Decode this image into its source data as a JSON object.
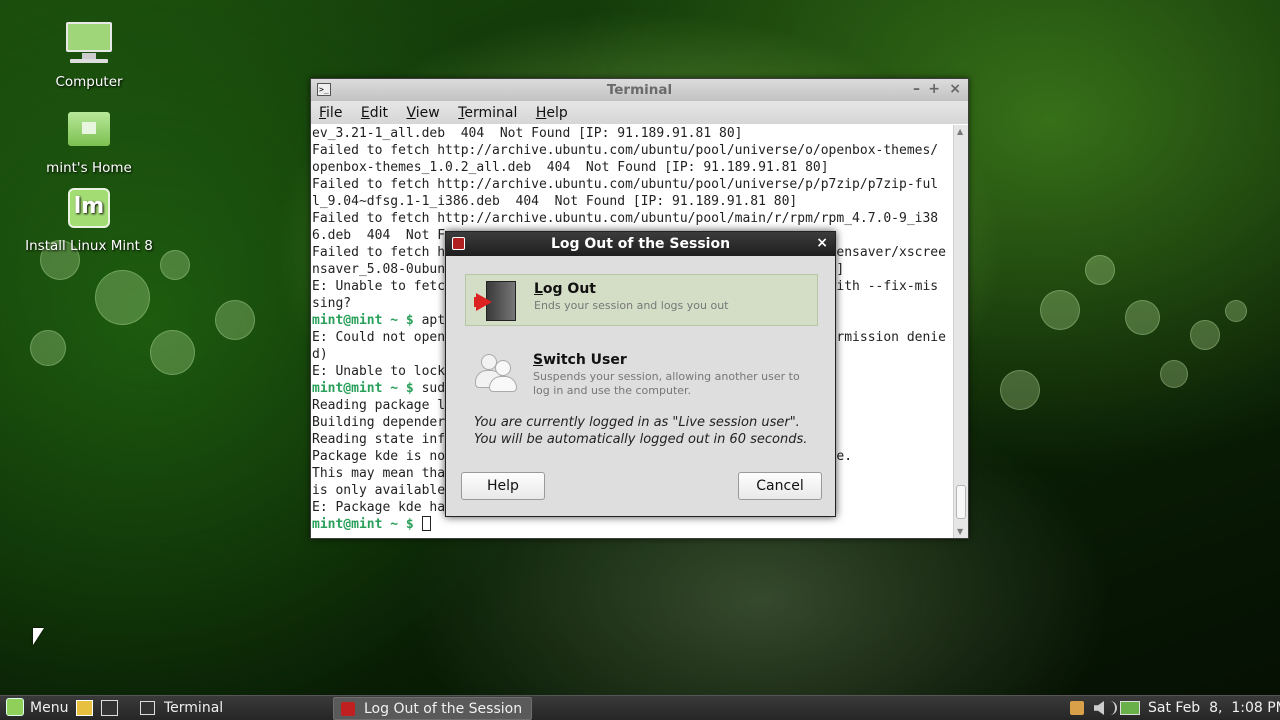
{
  "desktop": {
    "icons": [
      {
        "label": "Computer"
      },
      {
        "label": "mint's Home"
      },
      {
        "label": "Install Linux Mint 8"
      }
    ]
  },
  "terminal": {
    "title": "Terminal",
    "menu": [
      "File",
      "Edit",
      "View",
      "Terminal",
      "Help"
    ],
    "lines": [
      "ev_3.21-1_all.deb  404  Not Found [IP: 91.189.91.81 80]",
      "Failed to fetch http://archive.ubuntu.com/ubuntu/pool/universe/o/openbox-themes/",
      "openbox-themes_1.0.2_all.deb  404  Not Found [IP: 91.189.91.81 80]",
      "Failed to fetch http://archive.ubuntu.com/ubuntu/pool/universe/p/p7zip/p7zip-ful",
      "l_9.04~dfsg.1-1_i386.deb  404  Not Found [IP: 91.189.91.81 80]",
      "Failed to fetch http://archive.ubuntu.com/ubuntu/pool/main/r/rpm/rpm_4.7.0-9_i38",
      "6.deb  404  Not F",
      "Failed to fetch h                                                 eensaver/xscree",
      "nsaver_5.08-0ubun                                                 0]",
      "E: Unable to fetc                                                 with --fix-mis",
      "sing?",
      "",
      "E: Could not open                                                 ermission denie",
      "d)",
      "E: Unable to lock",
      "",
      "Reading package l",
      "Building depender",
      "Reading state inf",
      "Package kde is no                                                 ge.",
      "This may mean tha",
      "is only available",
      "E: Package kde ha",
      ""
    ],
    "prompt": "mint@mint ~ $",
    "prompt_lines": {
      "11": "apt",
      "15": "sud",
      "23": ""
    }
  },
  "dialog": {
    "title": "Log Out of the Session",
    "logout_name": "Log Out",
    "logout_desc": "Ends your session and logs you out",
    "switch_name": "Switch User",
    "switch_desc": "Suspends your session, allowing another user to log in and use the computer.",
    "message_line1": "You are currently logged in as \"Live session user\".",
    "message_line2": "You will be automatically logged out in 60 seconds.",
    "help_label": "Help",
    "cancel_label": "Cancel"
  },
  "taskbar": {
    "menu_label": "Menu",
    "tasks": [
      {
        "label": "Terminal",
        "active": false
      },
      {
        "label": "Log Out of the Session",
        "active": true
      }
    ],
    "clock": "Sat Feb  8,  1:08 PM"
  }
}
